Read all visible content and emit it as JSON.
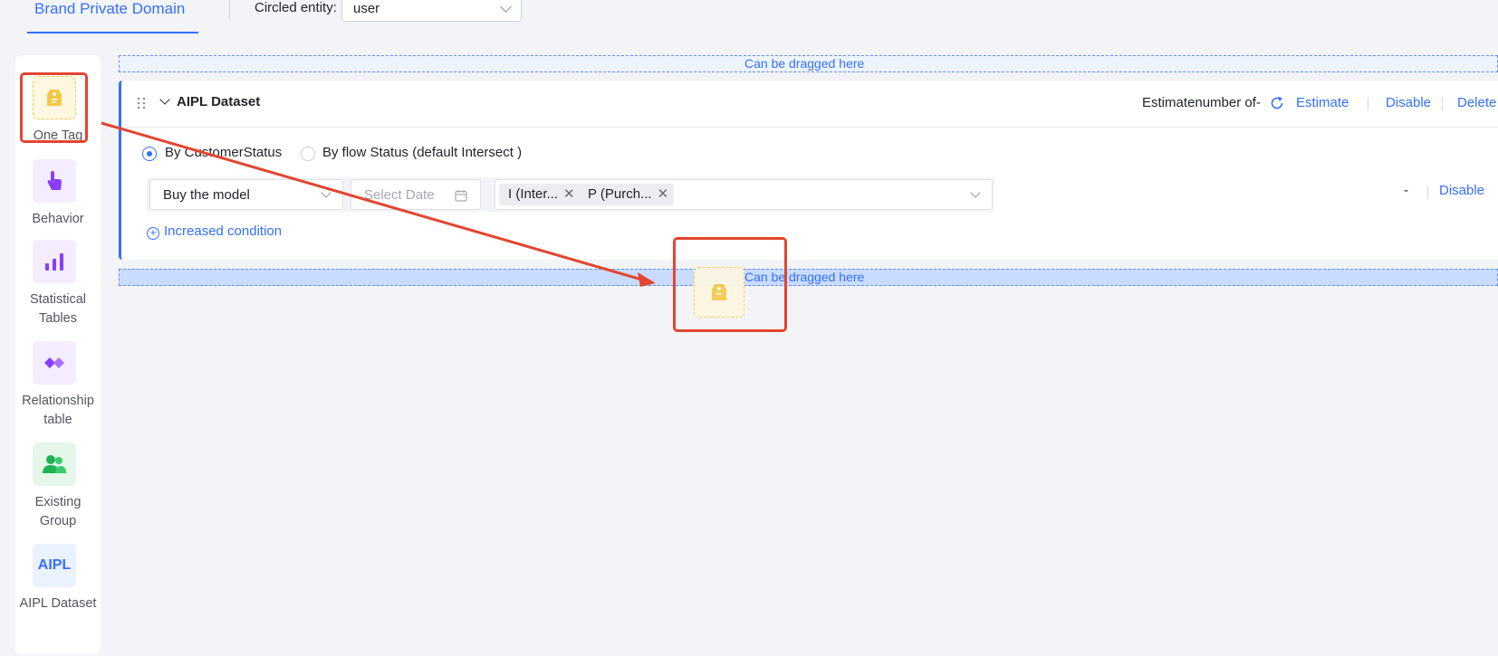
{
  "header": {
    "active_tab": "Brand Private Domain",
    "entity_label": "Circled entity:",
    "entity_value": "user"
  },
  "palette": {
    "items": [
      {
        "label": "One Tag",
        "icon": "tag-icon"
      },
      {
        "label": "Behavior",
        "icon": "pointer-hand-icon"
      },
      {
        "label": "Statistical Tables",
        "icon": "bar-chart-icon"
      },
      {
        "label": "Relationship table",
        "icon": "link-icon"
      },
      {
        "label": "Existing Group",
        "icon": "group-icon"
      },
      {
        "label": "AIPL Dataset",
        "icon_text": "AIPL"
      }
    ]
  },
  "dropzone": {
    "text": "Can be dragged here"
  },
  "card": {
    "title": "AIPL Dataset",
    "estimate_label": "Estimatenumber of-",
    "estimate_link": "Estimate",
    "disable_link": "Disable",
    "delete_link": "Delete",
    "radio_customer": "By CustomerStatus",
    "radio_flow": "By flow Status (default Intersect )",
    "condition": {
      "select_value": "Buy the model",
      "date_placeholder": "Select Date",
      "chips": [
        "I (Inter...",
        "P (Purch..."
      ],
      "dash": "-",
      "disable": "Disable"
    },
    "add_condition": "Increased condition"
  },
  "colors": {
    "accent": "#3370ff",
    "annotation_red": "#e3452f",
    "tag_yellow": "#f5c84a"
  }
}
